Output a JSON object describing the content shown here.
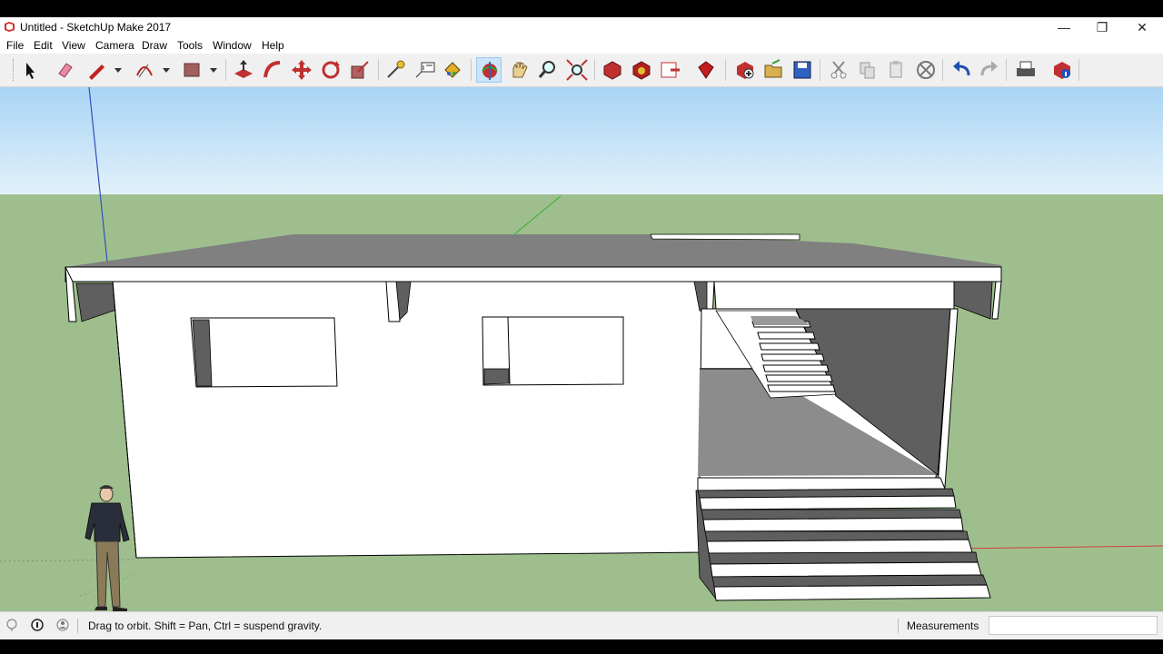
{
  "window": {
    "title": "Untitled - SketchUp Make 2017",
    "minimize_glyph": "—",
    "restore_glyph": "❐",
    "close_glyph": "✕"
  },
  "menu": [
    "File",
    "Edit",
    "View",
    "Camera",
    "Draw",
    "Tools",
    "Window",
    "Help"
  ],
  "toolbar": {
    "tools": [
      "select-icon",
      "eraser-icon",
      "pencil-line-icon",
      "arc-icon",
      "rectangle-icon",
      "push-pull-icon",
      "follow-me-icon",
      "move-icon",
      "rotate-icon",
      "scale-icon",
      "tape-measure-icon",
      "text-icon",
      "paint-bucket-icon",
      "orbit-icon",
      "pan-icon",
      "zoom-icon",
      "zoom-extents-icon",
      "3d-warehouse-icon",
      "extension-warehouse-icon",
      "send-to-layout-icon",
      "extension-manager-icon",
      "new-file-icon",
      "open-file-icon",
      "save-icon",
      "cut-icon",
      "copy-icon",
      "paste-icon",
      "erase-icon",
      "undo-icon",
      "redo-icon",
      "print-icon",
      "model-info-icon"
    ],
    "active_tool": "orbit-icon"
  },
  "colors": {
    "sky_top": "#a8d4f4",
    "sky_bottom": "#e3f1fb",
    "ground": "#9ebf8d",
    "house_wall": "#ffffff",
    "shadow_face": "#5f5f5f",
    "roof_top": "#808080",
    "axis_red": "#d04040",
    "axis_green": "#30b030",
    "axis_blue": "#3050c0"
  },
  "status": {
    "hint": "Drag to orbit. Shift = Pan, Ctrl = suspend gravity.",
    "measurements_label": "Measurements",
    "measurements_value": ""
  }
}
